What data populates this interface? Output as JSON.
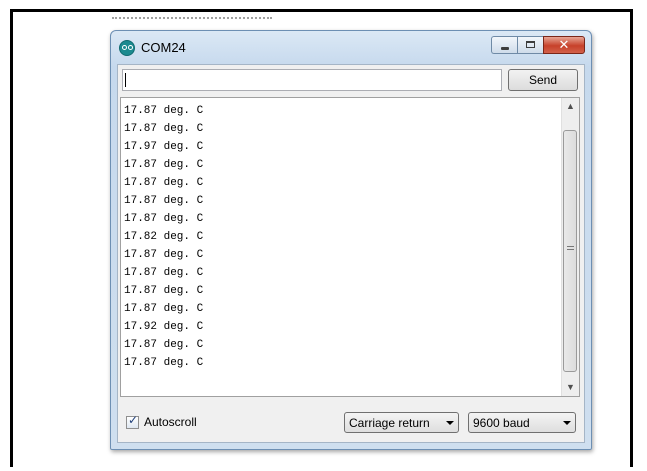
{
  "window": {
    "title": "COM24"
  },
  "input": {
    "value": "",
    "send_label": "Send"
  },
  "output": {
    "lines": [
      "17.87 deg. C",
      "17.87 deg. C",
      "17.97 deg. C",
      "17.87 deg. C",
      "17.87 deg. C",
      "17.87 deg. C",
      "17.87 deg. C",
      "17.82 deg. C",
      "17.87 deg. C",
      "17.87 deg. C",
      "17.87 deg. C",
      "17.87 deg. C",
      "17.92 deg. C",
      "17.87 deg. C",
      "17.87 deg. C"
    ]
  },
  "footer": {
    "autoscroll_label": "Autoscroll",
    "autoscroll_checked": true,
    "line_ending": "Carriage return",
    "baud": "9600 baud"
  },
  "icons": {
    "app": "arduino-icon",
    "minimize": "minimize-icon",
    "maximize": "maximize-icon",
    "close": "close-icon"
  }
}
